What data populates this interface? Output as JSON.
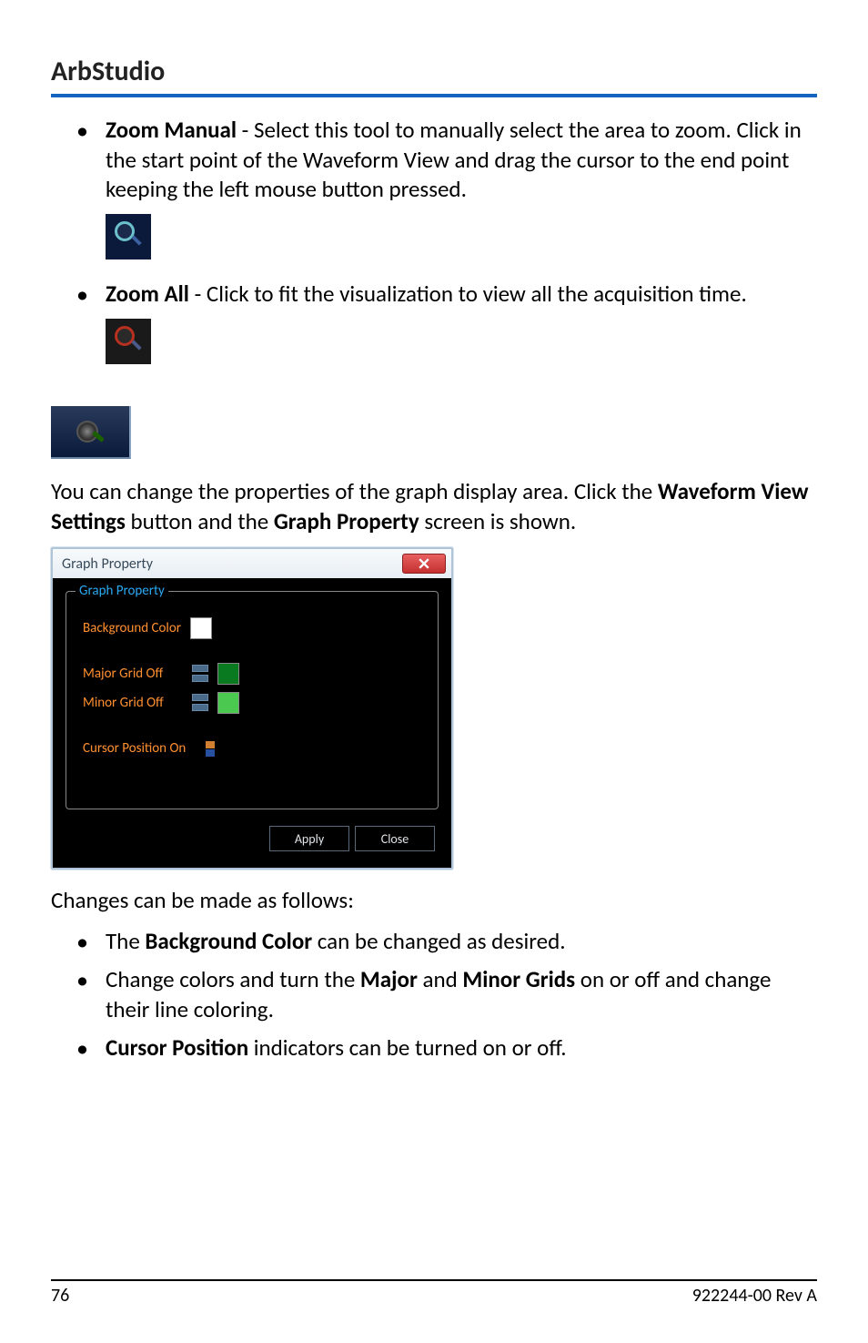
{
  "header": {
    "title": "ArbStudio"
  },
  "list_top": [
    {
      "bold": "Zoom Manual",
      "rest": " - Select this tool to manually select the area to zoom. Click in the start point of the Waveform View and drag the cursor to the end point keeping the left mouse button pressed."
    },
    {
      "bold": "Zoom All",
      "rest": " - Click to fit the visualization to view all the acquisition time."
    }
  ],
  "para": {
    "pre": "You can change the properties of the graph display area. Click the ",
    "b1": "Waveform View Settings",
    "mid": " button and the ",
    "b2": "Graph Property",
    "post": " screen is shown."
  },
  "dialog": {
    "title": "Graph Property",
    "legend": "Graph Property",
    "bg_label": "Background Color",
    "major_label": "Major Grid Off",
    "minor_label": "Minor Grid Off",
    "cursor_label": "Cursor Position On",
    "apply": "Apply",
    "close": "Close"
  },
  "changes_intro": "Changes can be made as follows:",
  "list_bottom": [
    {
      "pre": "The ",
      "b1": "Background Color",
      "post": " can be changed as desired."
    },
    {
      "pre": "Change colors and turn the ",
      "b1": "Major",
      "mid": " and ",
      "b2": "Minor Grids",
      "post": " on or off and change their line coloring."
    },
    {
      "pre": "",
      "b1": "Cursor Position",
      "post": " indicators can be turned on or off."
    }
  ],
  "footer": {
    "page": "76",
    "rev": "922244-00 Rev A"
  }
}
